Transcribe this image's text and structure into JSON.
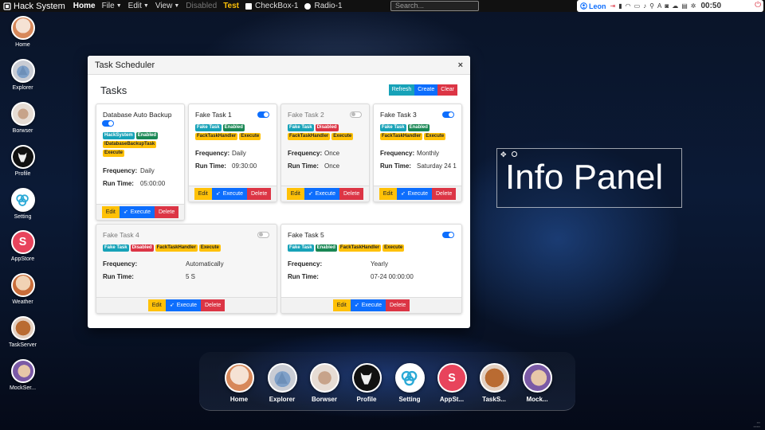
{
  "topbar": {
    "brand": "Hack System",
    "menu": [
      {
        "label": "Home",
        "state": "active",
        "caret": false
      },
      {
        "label": "File",
        "state": "normal",
        "caret": true
      },
      {
        "label": "Edit",
        "state": "normal",
        "caret": true
      },
      {
        "label": "View",
        "state": "normal",
        "caret": true
      },
      {
        "label": "Disabled",
        "state": "disabled",
        "caret": false
      },
      {
        "label": "Test",
        "state": "test",
        "caret": false
      }
    ],
    "checkbox_label": "CheckBox-1",
    "radio_label": "Radio-1",
    "search_placeholder": "Search..."
  },
  "tray": {
    "user": "Leon",
    "clock": "00:50",
    "icons": [
      "login-icon",
      "signal-icon",
      "wifi-icon",
      "battery-icon",
      "bell-icon",
      "usb-icon",
      "font-icon",
      "camera-icon",
      "cloud-icon",
      "printer-icon",
      "settings-icon"
    ]
  },
  "left_dock": [
    {
      "label": "Home",
      "icon": "home-icon",
      "class": "i-home"
    },
    {
      "label": "Explorer",
      "icon": "explorer-icon",
      "class": "i-explorer"
    },
    {
      "label": "Borwser",
      "icon": "browser-icon",
      "class": "i-browser"
    },
    {
      "label": "Profile",
      "icon": "profile-icon",
      "class": "i-profile"
    },
    {
      "label": "Setting",
      "icon": "setting-icon",
      "class": "i-setting"
    },
    {
      "label": "AppStore",
      "icon": "appstore-icon",
      "class": "i-appstore"
    },
    {
      "label": "Weather",
      "icon": "weather-icon",
      "class": "i-weather"
    },
    {
      "label": "TaskServer",
      "icon": "taskserver-icon",
      "class": "i-task"
    },
    {
      "label": "MockSer...",
      "icon": "mockserver-icon",
      "class": "i-mock"
    }
  ],
  "bottom_dock": [
    {
      "label": "Home",
      "icon": "home-icon",
      "class": "i-home"
    },
    {
      "label": "Explorer",
      "icon": "explorer-icon",
      "class": "i-explorer"
    },
    {
      "label": "Borwser",
      "icon": "browser-icon",
      "class": "i-browser"
    },
    {
      "label": "Profile",
      "icon": "profile-icon",
      "class": "i-profile"
    },
    {
      "label": "Setting",
      "icon": "setting-icon",
      "class": "i-setting"
    },
    {
      "label": "AppSt...",
      "icon": "appstore-icon",
      "class": "i-appstore"
    },
    {
      "label": "TaskS...",
      "icon": "taskserver-icon",
      "class": "i-task"
    },
    {
      "label": "Mock...",
      "icon": "mockserver-icon",
      "class": "i-mock"
    }
  ],
  "modal": {
    "title": "Task Scheduler",
    "close": "×",
    "heading": "Tasks",
    "toolbar": {
      "refresh": "Refresh",
      "create": "Create",
      "clear": "Clear"
    },
    "labels": {
      "frequency": "Frequency:",
      "run_time": "Run Time:"
    },
    "footer": {
      "edit": "Edit",
      "execute": "Execute",
      "delete": "Delete"
    },
    "tasks": [
      {
        "title": "Database Auto Backup",
        "enabled": true,
        "badges": [
          {
            "text": "HackSystem",
            "color": "info"
          },
          {
            "text": "Enabled",
            "color": "success"
          },
          {
            "text": "IDatabaseBackupTask",
            "color": "warning"
          },
          {
            "text": "Execute",
            "color": "warning"
          }
        ],
        "frequency": "Daily",
        "run_time": "05:00:00"
      },
      {
        "title": "Fake Task 1",
        "enabled": true,
        "badges": [
          {
            "text": "Fake Task",
            "color": "info"
          },
          {
            "text": "Enabled",
            "color": "success"
          },
          {
            "text": "FackTaskHandler",
            "color": "warning"
          },
          {
            "text": "Execute",
            "color": "warning"
          }
        ],
        "frequency": "Daily",
        "run_time": "09:30:00"
      },
      {
        "title": "Fake Task 2",
        "enabled": false,
        "badges": [
          {
            "text": "Fake Task",
            "color": "info"
          },
          {
            "text": "Disabled",
            "color": "danger"
          },
          {
            "text": "FackTaskHandler",
            "color": "warning"
          },
          {
            "text": "Execute",
            "color": "warning"
          }
        ],
        "frequency": "Once",
        "run_time": "Once"
      },
      {
        "title": "Fake Task 3",
        "enabled": true,
        "badges": [
          {
            "text": "Fake Task",
            "color": "info"
          },
          {
            "text": "Enabled",
            "color": "success"
          },
          {
            "text": "FackTaskHandler",
            "color": "warning"
          },
          {
            "text": "Execute",
            "color": "warning"
          }
        ],
        "frequency": "Monthly",
        "run_time": "Saturday 24 1"
      },
      {
        "title": "Fake Task 4",
        "enabled": false,
        "badges": [
          {
            "text": "Fake Task",
            "color": "info"
          },
          {
            "text": "Disabled",
            "color": "danger"
          },
          {
            "text": "FackTaskHandler",
            "color": "warning"
          },
          {
            "text": "Execute",
            "color": "warning"
          }
        ],
        "frequency": "Automatically",
        "run_time": "5 S"
      },
      {
        "title": "Fake Task 5",
        "enabled": true,
        "badges": [
          {
            "text": "Fake Task",
            "color": "info"
          },
          {
            "text": "Enabled",
            "color": "success"
          },
          {
            "text": "FackTaskHandler",
            "color": "warning"
          },
          {
            "text": "Execute",
            "color": "warning"
          }
        ],
        "frequency": "Yearly",
        "run_time": "07-24 00:00:00"
      }
    ]
  },
  "info_panel": {
    "text": "Info Panel"
  },
  "colors": {
    "info": "#17a2b8",
    "primary": "#0d6efd",
    "danger": "#dc3545",
    "success": "#198754",
    "warning": "#ffc107"
  }
}
